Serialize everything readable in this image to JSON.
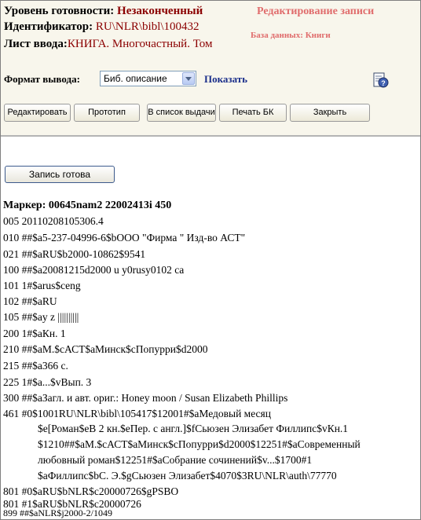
{
  "header": {
    "status_label": "Уровень готовности:",
    "status_value": "Незаконченный",
    "id_label": "Идентификатор:",
    "id_value": "RU\\NLR\\bibl\\100432",
    "sheet_label": "Лист ввода:",
    "sheet_value": "КНИГА. Многочастный. Том",
    "edit_title": "Редактирование записи",
    "db_label": "База данных:",
    "db_value": "Книги"
  },
  "format": {
    "label": "Формат вывода:",
    "selected": "Биб. описание",
    "show_label": "Показать"
  },
  "toolbar": {
    "edit": "Редактировать",
    "prototype": "Прототип",
    "to_list": "В список выдачи",
    "print": "Печать БК",
    "close": "Закрыть"
  },
  "ready_button": "Запись готова",
  "marker": "Маркер: 00645nam2 22002413i 450",
  "records": [
    "005 20110208105306.4",
    "010 ##$a5-237-04996-6$bООО \"Фирма \" Изд-во АСТ\"",
    "021 ##$aRU$b2000-10862$9541",
    "100 ##$a20081215d2000 u y0rusy0102 ca",
    "101 1#$arus$ceng",
    "102 ##$aRU",
    "105 ##$ay z ||||||||||",
    "200 1#$aКн. 1",
    "210 ##$aМ.$cАСТ$aМинск$cПопурри$d2000",
    "215 ##$a366 с.",
    "225 1#$a...$vВып. 3",
    "300 ##$aЗагл. и авт. ориг.: Honey moon / Susan Elizabeth Phillips",
    "461 #0$1001RU\\NLR\\bibl\\105417$12001#$aМедовый месяц"
  ],
  "record_461_cont": [
    "$e[Роман$eВ 2 кн.$eПер. с англ.]$fСьюзен Элизабет Филлипс$vКн.1",
    "$1210##$aМ.$cАСТ$aМинск$cПопурри$d2000$12251#$aСовременный",
    "любовный роман$12251#$aСобрание сочинений$v...$1700#1",
    "$aФиллипс$bС. Э.$gСьюзен Элизабет$4070$3RU\\NLR\\auth\\77770"
  ],
  "records_after": [
    "801 #0$aRU$bNLR$c20000726$gPSBO",
    "801 #1$aRU$bNLR$c20000726",
    "899 ##$aNLR$j2000-2/1049"
  ]
}
